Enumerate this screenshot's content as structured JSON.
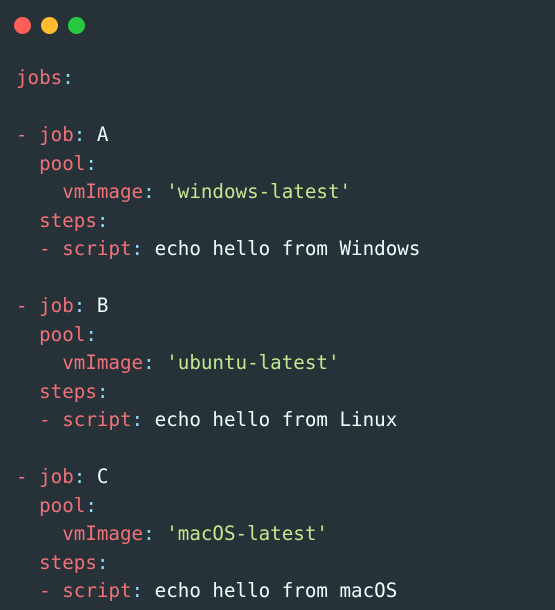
{
  "window": {
    "controls": {
      "close_color": "#ff5f57",
      "minimize_color": "#febc2e",
      "maximize_color": "#28c840"
    }
  },
  "colors": {
    "background": "#263238",
    "key": "#f07178",
    "punctuation": "#89ddff",
    "string": "#c3e88d",
    "text": "#eeffff"
  },
  "code": {
    "root_key": "jobs",
    "jobs": [
      {
        "dash": "-",
        "job_key": "job",
        "job_value": "A",
        "pool_key": "pool",
        "vm_key": "vmImage",
        "vm_value": "'windows-latest'",
        "steps_key": "steps",
        "script_dash": "-",
        "script_key": "script",
        "script_value": "echo hello from Windows"
      },
      {
        "dash": "-",
        "job_key": "job",
        "job_value": "B",
        "pool_key": "pool",
        "vm_key": "vmImage",
        "vm_value": "'ubuntu-latest'",
        "steps_key": "steps",
        "script_dash": "-",
        "script_key": "script",
        "script_value": "echo hello from Linux"
      },
      {
        "dash": "-",
        "job_key": "job",
        "job_value": "C",
        "pool_key": "pool",
        "vm_key": "vmImage",
        "vm_value": "'macOS-latest'",
        "steps_key": "steps",
        "script_dash": "-",
        "script_key": "script",
        "script_value": "echo hello from macOS"
      }
    ]
  }
}
